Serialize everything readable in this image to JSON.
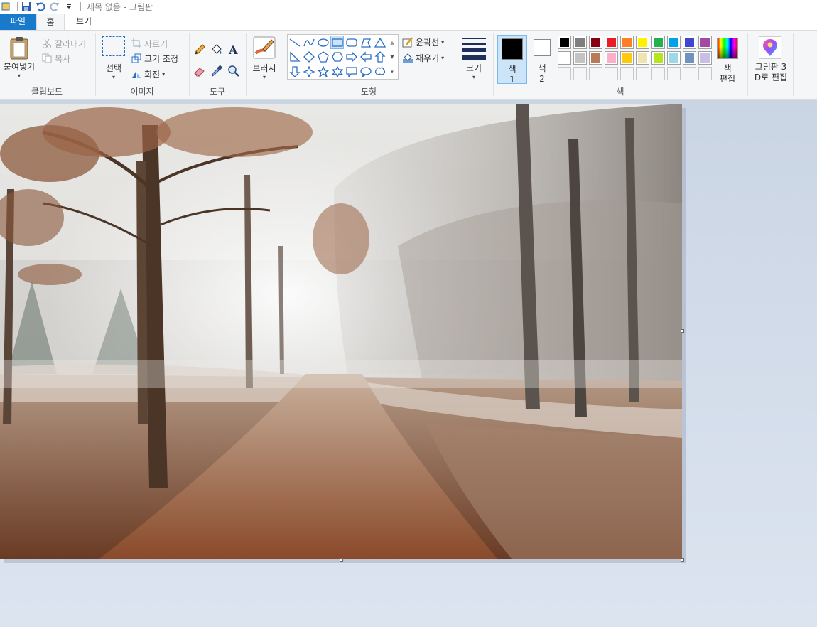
{
  "titlebar": {
    "title": "제목 없음 - 그림판",
    "icons": [
      "paint-app-icon",
      "save-icon",
      "undo-icon",
      "redo-icon",
      "customize-dropdown-icon"
    ]
  },
  "tabs": [
    {
      "label": "파일",
      "active": false
    },
    {
      "label": "홈",
      "active": true
    },
    {
      "label": "보기",
      "active": false
    }
  ],
  "ribbon": {
    "clipboard": {
      "label": "클립보드",
      "paste": "붙여넣기",
      "cut": "잘라내기",
      "copy": "복사"
    },
    "image": {
      "label": "이미지",
      "select": "선택",
      "crop": "자르기",
      "resize": "크기 조정",
      "rotate": "회전"
    },
    "tools": {
      "label": "도구",
      "items": [
        "pencil-icon",
        "fill-icon",
        "text-icon",
        "eraser-icon",
        "color-picker-icon",
        "magnifier-icon"
      ]
    },
    "brushes": {
      "label": "브러시"
    },
    "shapes": {
      "label": "도형",
      "outline": "윤곽선",
      "fill": "채우기"
    },
    "size": {
      "label": "크기"
    },
    "colors": {
      "label": "색",
      "color1_label_a": "색",
      "color1_label_b": "1",
      "color2_label_a": "색",
      "color2_label_b": "2",
      "edit_label_a": "색",
      "edit_label_b": "편집",
      "color1": "#000000",
      "color2": "#ffffff",
      "palette_row1": [
        "#000000",
        "#7f7f7f",
        "#880015",
        "#ed1c24",
        "#ff7f27",
        "#fff200",
        "#22b14c",
        "#00a2e8",
        "#3f48cc",
        "#a349a4"
      ],
      "palette_row2": [
        "#ffffff",
        "#c3c3c3",
        "#b97a57",
        "#ffaec9",
        "#ffc90e",
        "#efe4b0",
        "#b5e61d",
        "#99d9ea",
        "#7092be",
        "#c8bfe7"
      ]
    },
    "paint3d": {
      "label_a": "그림판 3",
      "label_b": "D로 편집"
    }
  },
  "canvas": {
    "description_icon": "canvas-image",
    "background": "#d9d6d2"
  }
}
